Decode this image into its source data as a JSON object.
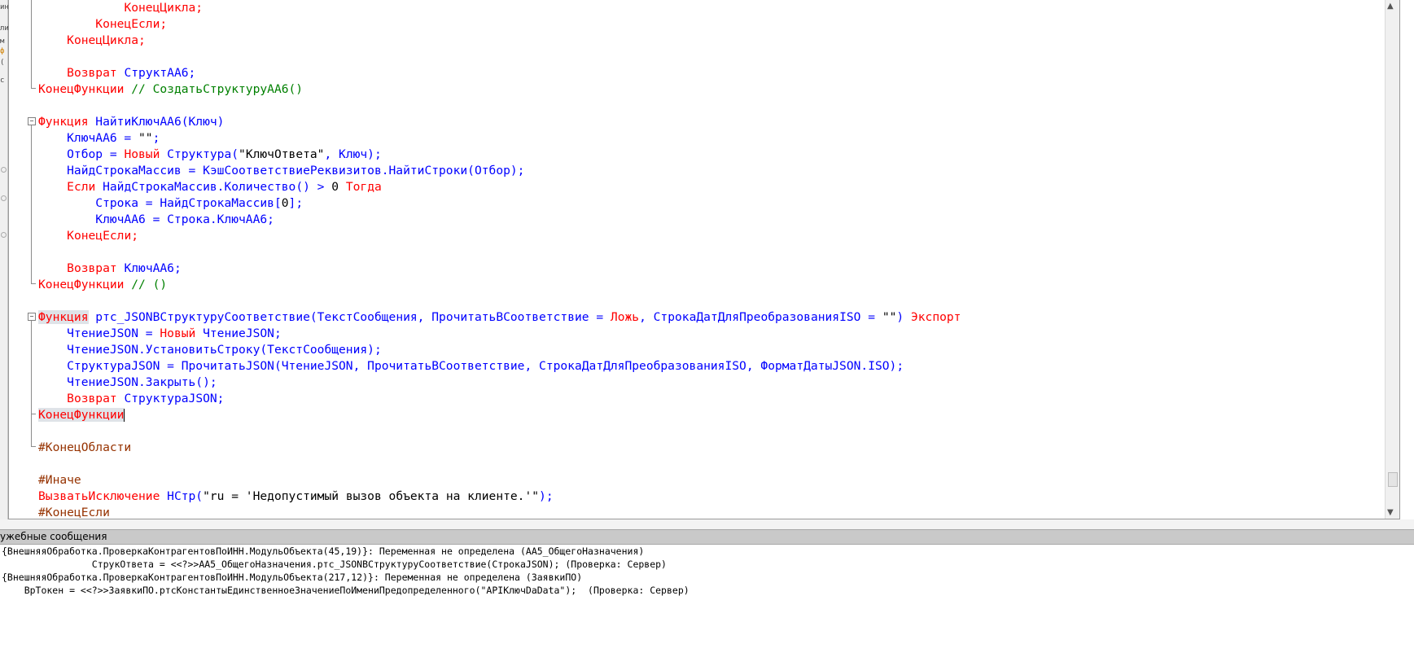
{
  "left_strip": {
    "fragments": [
      "ин",
      "ли",
      "м",
      "ф",
      "(",
      "с"
    ]
  },
  "editor": {
    "lines": [
      [
        {
          "t": "            "
        },
        {
          "t": "КонецЦикла;",
          "c": "kw"
        }
      ],
      [
        {
          "t": "        "
        },
        {
          "t": "КонецЕсли;",
          "c": "kw"
        }
      ],
      [
        {
          "t": "    "
        },
        {
          "t": "КонецЦикла;",
          "c": "kw"
        }
      ],
      [
        {
          "t": ""
        }
      ],
      [
        {
          "t": "    "
        },
        {
          "t": "Возврат",
          "c": "kw"
        },
        {
          "t": " СтруктАА6;"
        }
      ],
      [
        {
          "t": "КонецФункции",
          "c": "kw"
        },
        {
          "t": " // СоздатьСтруктуруАА6()",
          "c": "cm"
        }
      ],
      [
        {
          "t": ""
        }
      ],
      [
        {
          "t": "Функция",
          "c": "kw"
        },
        {
          "t": " НайтиКлючАА6(Ключ)"
        }
      ],
      [
        {
          "t": "    КлючАА6 = "
        },
        {
          "t": "\"\"",
          "c": "blk"
        },
        {
          "t": ";"
        }
      ],
      [
        {
          "t": "    Отбор = "
        },
        {
          "t": "Новый",
          "c": "kw"
        },
        {
          "t": " Структура("
        },
        {
          "t": "\"КлючОтвета\"",
          "c": "blk"
        },
        {
          "t": ", Ключ);"
        }
      ],
      [
        {
          "t": "    НайдСтрокаМассив = КэшСоответствиеРеквизитов.НайтиСтроки(Отбор);"
        }
      ],
      [
        {
          "t": "    "
        },
        {
          "t": "Если",
          "c": "kw"
        },
        {
          "t": " НайдСтрокаМассив.Количество() > "
        },
        {
          "t": "0",
          "c": "blk"
        },
        {
          "t": " "
        },
        {
          "t": "Тогда",
          "c": "kw"
        }
      ],
      [
        {
          "t": "        Строка = НайдСтрокаМассив["
        },
        {
          "t": "0",
          "c": "blk"
        },
        {
          "t": "];"
        }
      ],
      [
        {
          "t": "        КлючАА6 = Строка.КлючАА6;"
        }
      ],
      [
        {
          "t": "    "
        },
        {
          "t": "КонецЕсли;",
          "c": "kw"
        }
      ],
      [
        {
          "t": ""
        }
      ],
      [
        {
          "t": "    "
        },
        {
          "t": "Возврат",
          "c": "kw"
        },
        {
          "t": " КлючАА6;"
        }
      ],
      [
        {
          "t": "КонецФункции",
          "c": "kw"
        },
        {
          "t": " // ()",
          "c": "cm"
        }
      ],
      [
        {
          "t": ""
        }
      ],
      [
        {
          "t": "Функция",
          "c": "kw hl"
        },
        {
          "t": " ртс_JSONВСтруктуруСоответствие(ТекстСообщения, ПрочитатьВСоответствие = "
        },
        {
          "t": "Ложь",
          "c": "kw"
        },
        {
          "t": ", СтрокаДатДляПреобразованияISO = "
        },
        {
          "t": "\"\"",
          "c": "blk"
        },
        {
          "t": ") "
        },
        {
          "t": "Экспорт",
          "c": "kw"
        }
      ],
      [
        {
          "t": "    ЧтениеJSON = "
        },
        {
          "t": "Новый",
          "c": "kw"
        },
        {
          "t": " ЧтениеJSON;"
        }
      ],
      [
        {
          "t": "    ЧтениеJSON.УстановитьСтроку(ТекстСообщения);"
        }
      ],
      [
        {
          "t": "    СтруктураJSON = ПрочитатьJSON(ЧтениеJSON, ПрочитатьВСоответствие, СтрокаДатДляПреобразованияISO, ФорматДатыJSON.ISO);"
        }
      ],
      [
        {
          "t": "    ЧтениеJSON.Закрыть();"
        }
      ],
      [
        {
          "t": "    "
        },
        {
          "t": "Возврат",
          "c": "kw"
        },
        {
          "t": " СтруктураJSON;"
        }
      ],
      [
        {
          "t": "КонецФункции",
          "c": "kw hl"
        },
        {
          "caret": true
        }
      ],
      [
        {
          "t": ""
        }
      ],
      [
        {
          "t": "#КонецОбласти",
          "c": "pp"
        }
      ],
      [
        {
          "t": ""
        }
      ],
      [
        {
          "t": "#Иначе",
          "c": "pp"
        }
      ],
      [
        {
          "t": "ВызватьИсключение",
          "c": "kw"
        },
        {
          "t": " НСтр("
        },
        {
          "t": "\"ru = 'Недопустимый вызов объекта на клиенте.'\"",
          "c": "blk"
        },
        {
          "t": ");"
        }
      ],
      [
        {
          "t": "#КонецЕсли",
          "c": "pp"
        }
      ]
    ]
  },
  "messages_panel": {
    "title": "ужебные сообщения",
    "lines": [
      "{ВнешняяОбработка.ПроверкаКонтрагентовПоИНН.МодульОбъекта(45,19)}: Переменная не определена (АА5_ОбщегоНазначения)",
      "                СтрукОтвета = <<?>>АА5_ОбщегоНазначения.ртс_JSONВСтруктуруСоответствие(СтрокаJSON); (Проверка: Сервер)",
      "{ВнешняяОбработка.ПроверкаКонтрагентовПоИНН.МодульОбъекта(217,12)}: Переменная не определена (ЗаявкиПО)",
      "    ВрТокен = <<?>>ЗаявкиПО.ртсКонстантыЕдинственноеЗначениеПоИмениПредопределенного(\"APIКлючDaData\");  (Проверка: Сервер)"
    ]
  }
}
